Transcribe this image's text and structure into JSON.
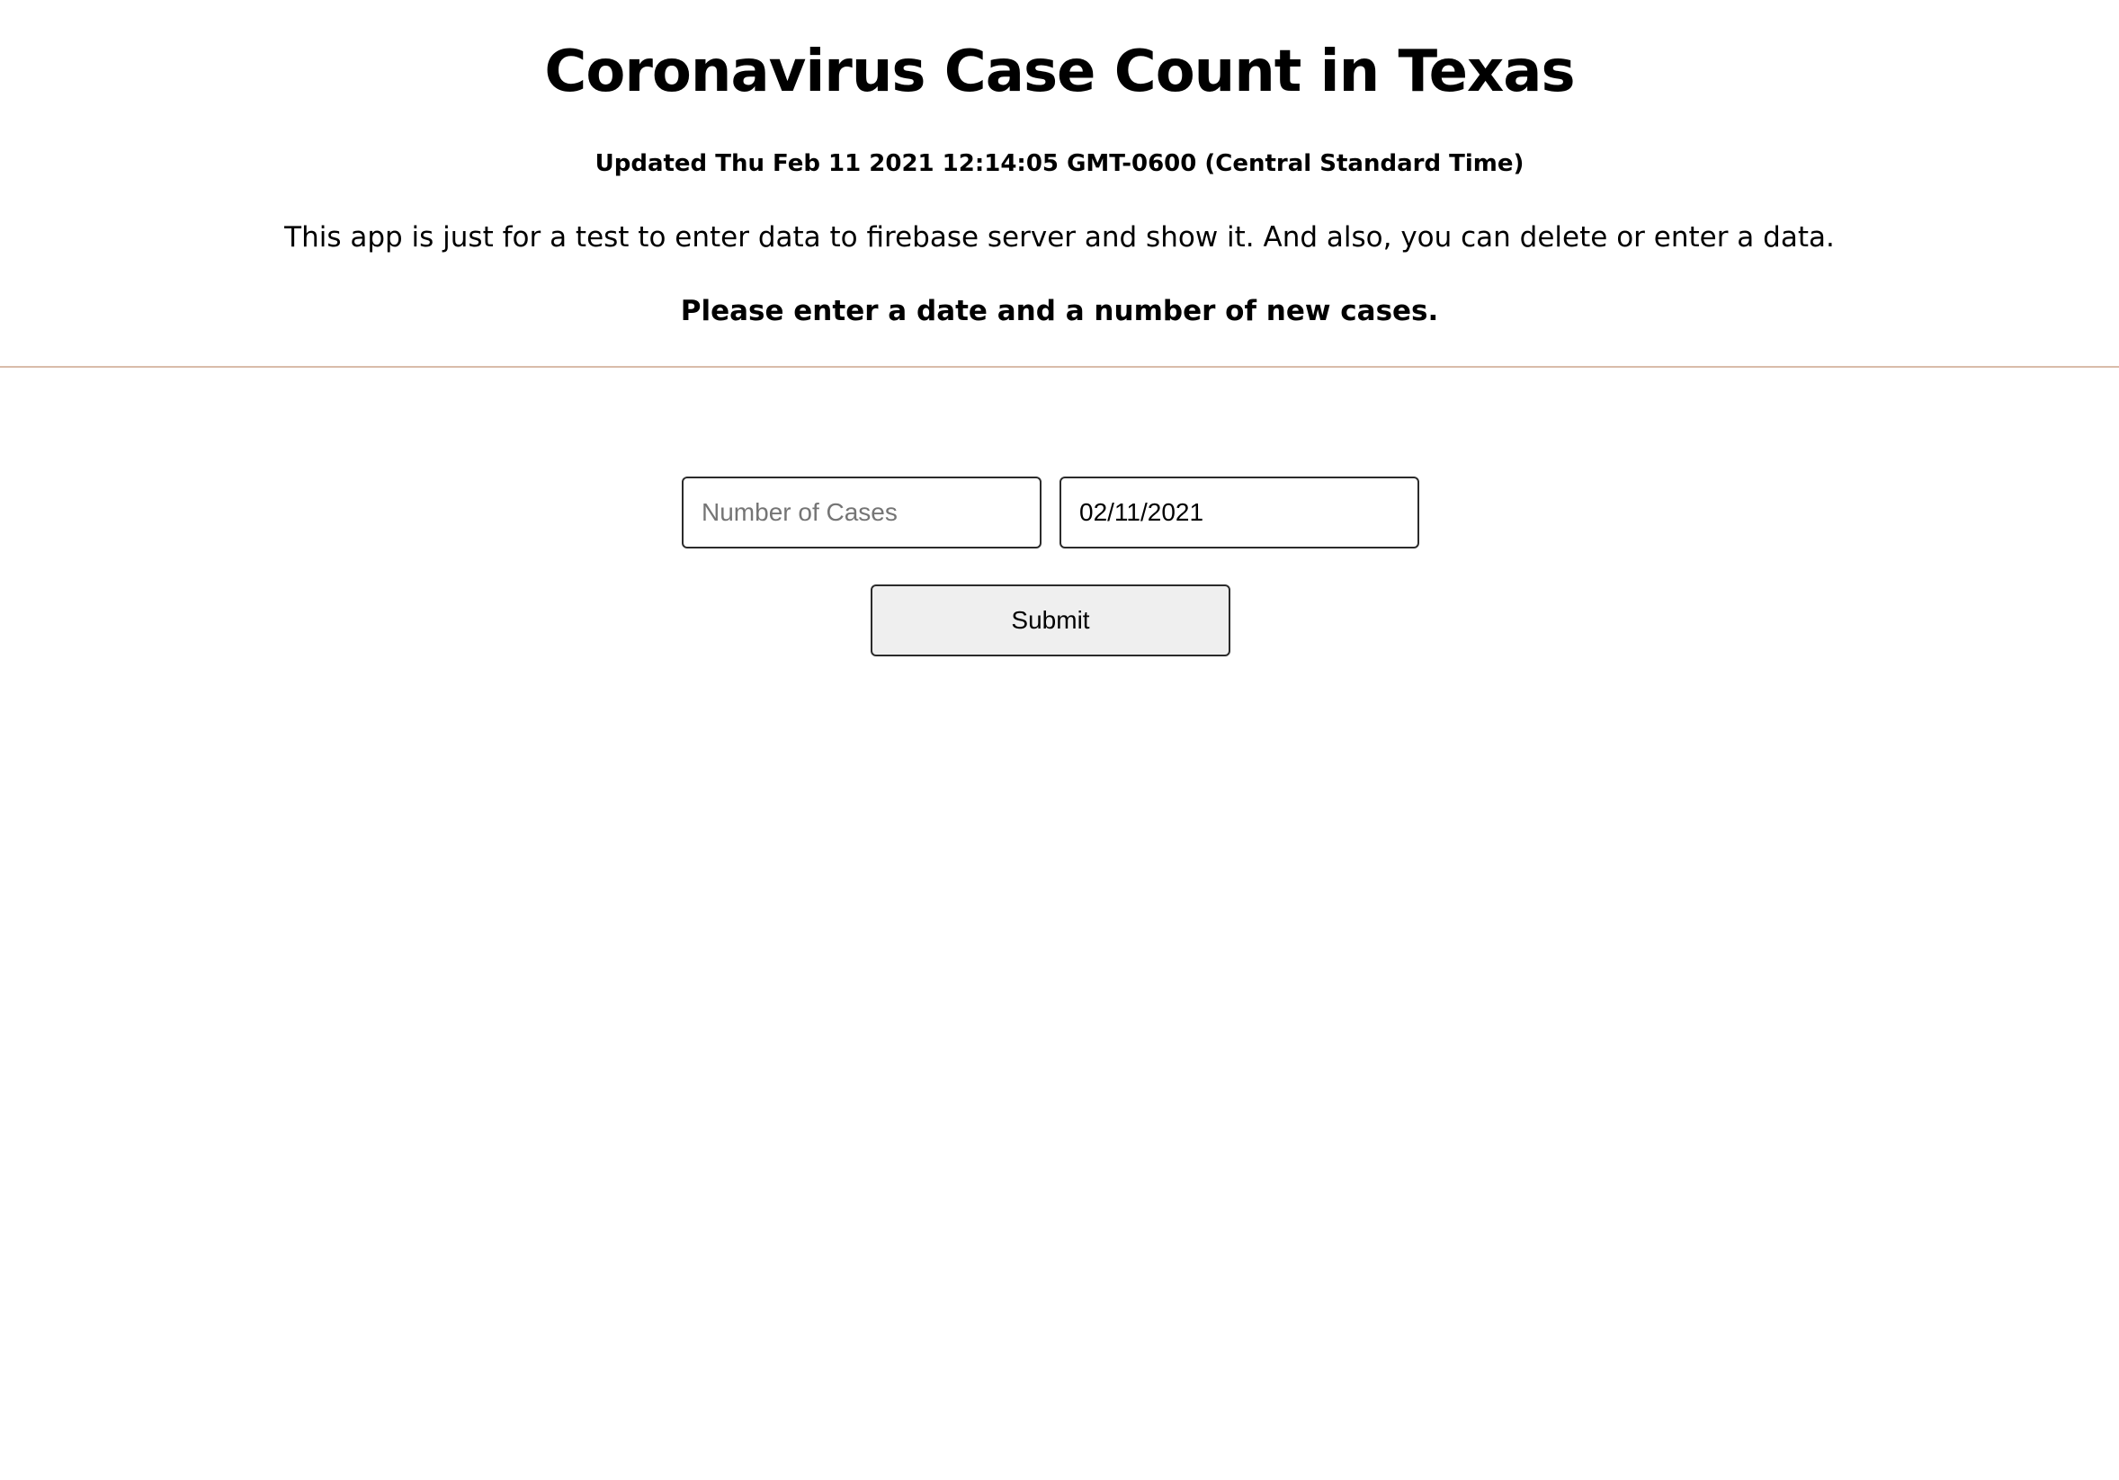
{
  "header": {
    "title": "Coronavirus Case Count in Texas",
    "updated": "Updated Thu Feb 11 2021 12:14:05 GMT-0600 (Central Standard Time)",
    "description": "This app is just for a test to enter data to firebase server and show it. And also, you can delete or enter a data.",
    "instruction": "Please enter a date and a number of new cases."
  },
  "form": {
    "cases_input": {
      "value": "",
      "placeholder": "Number of Cases"
    },
    "date_input": {
      "value": "02/11/2021",
      "placeholder": ""
    },
    "submit_label": "Submit"
  },
  "colors": {
    "divider": "#d9bcaa",
    "button_background": "#efefef",
    "field_border": "#2b2b2b"
  }
}
